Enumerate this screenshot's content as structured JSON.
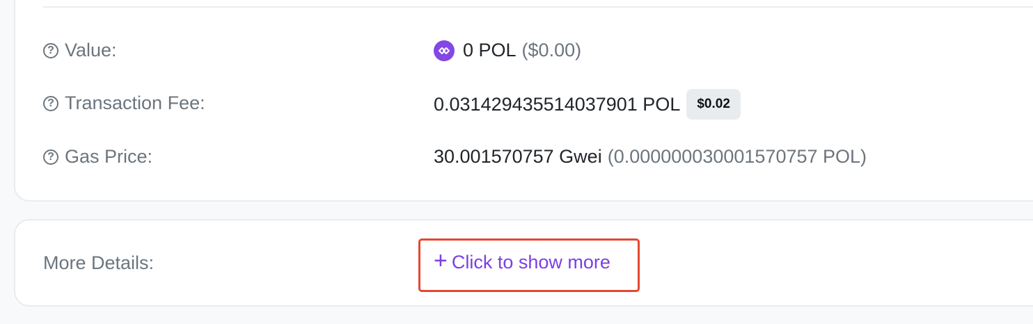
{
  "details": {
    "value": {
      "label": "Value:",
      "amount": "0 POL",
      "usd": "($0.00)",
      "icon": "polygon-icon"
    },
    "transaction_fee": {
      "label": "Transaction Fee:",
      "amount": "0.031429435514037901 POL",
      "usd_badge": "$0.02"
    },
    "gas_price": {
      "label": "Gas Price:",
      "amount": "30.001570757 Gwei",
      "pol": "(0.000000030001570757 POL)"
    }
  },
  "more_details": {
    "label": "More Details:",
    "link_plus": "+",
    "link_label": "Click to show more"
  },
  "colors": {
    "accent": "#7b3fe4",
    "polygon": "#8247e5",
    "highlight_border": "#e5472e",
    "muted_text": "#6c757d"
  }
}
